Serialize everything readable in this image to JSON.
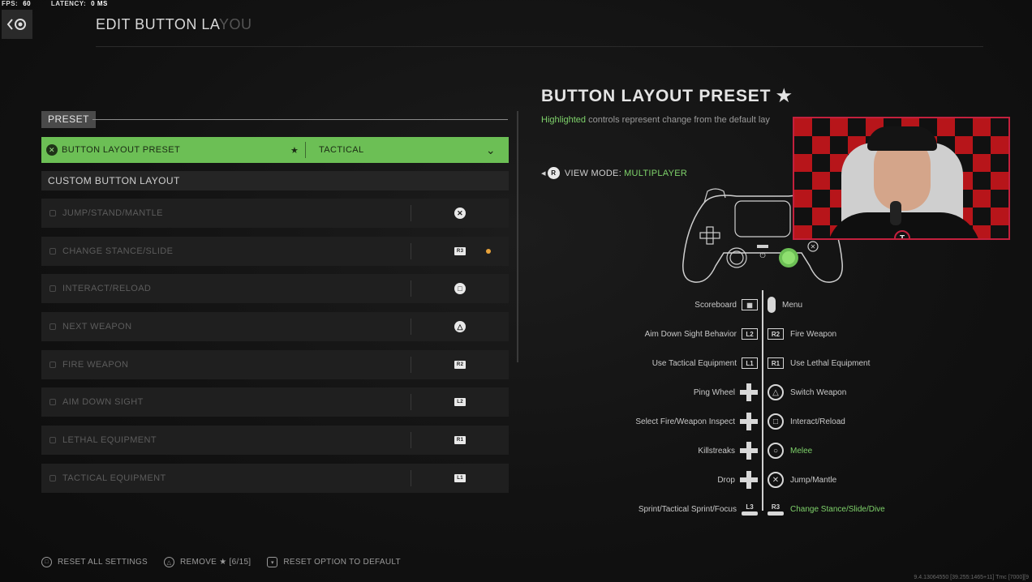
{
  "stats": {
    "fps_label": "FPS:",
    "fps_value": "60",
    "latency_label": "LATENCY:",
    "latency_value": "0 MS"
  },
  "header": {
    "title_visible": "EDIT BUTTON LA",
    "title_faded": "YOU"
  },
  "left": {
    "preset_tag": "PRESET",
    "preset_row": {
      "label": "BUTTON LAYOUT PRESET",
      "star": "★",
      "value": "TACTICAL",
      "bg_color": "#6cbf55"
    },
    "custom_header": "CUSTOM BUTTON LAYOUT",
    "rows": [
      {
        "label": "JUMP/STAND/MANTLE",
        "button": "✕",
        "button_type": "circle"
      },
      {
        "label": "CHANGE STANCE/SLIDE",
        "button": "R3",
        "button_type": "stick",
        "changed": true
      },
      {
        "label": "INTERACT/RELOAD",
        "button": "□",
        "button_type": "circle"
      },
      {
        "label": "NEXT WEAPON",
        "button": "△",
        "button_type": "circle"
      },
      {
        "label": "FIRE WEAPON",
        "button": "R2",
        "button_type": "tag"
      },
      {
        "label": "AIM DOWN SIGHT",
        "button": "L2",
        "button_type": "tag"
      },
      {
        "label": "LETHAL EQUIPMENT",
        "button": "R1",
        "button_type": "tag"
      },
      {
        "label": "TACTICAL EQUIPMENT",
        "button": "L1",
        "button_type": "tag"
      }
    ]
  },
  "footer": {
    "reset_all": "RESET ALL SETTINGS",
    "remove": "REMOVE ★ [6/15]",
    "reset_option": "RESET OPTION TO DEFAULT",
    "build": "9.4.13064550 [39.255:1465+11] Tmc [7000][9"
  },
  "right": {
    "title": "BUTTON LAYOUT PRESET ★",
    "note_highlight": "Highlighted",
    "note_rest": " controls represent change from the default lay",
    "view_mode_label": "VIEW MODE:",
    "view_mode_value": "MULTIPLAYER",
    "accent_color": "#7fd36b",
    "mapping_left": [
      {
        "label": "Scoreboard",
        "icon": "touchpad-icon"
      },
      {
        "label": "Aim Down Sight Behavior",
        "icon": "L2"
      },
      {
        "label": "Use Tactical Equipment",
        "icon": "L1"
      },
      {
        "label": "Ping Wheel",
        "icon": "dpad-icon"
      },
      {
        "label": "Select Fire/Weapon Inspect",
        "icon": "dpad-icon"
      },
      {
        "label": "Killstreaks",
        "icon": "dpad-icon"
      },
      {
        "label": "Drop",
        "icon": "dpad-icon"
      },
      {
        "label": "Sprint/Tactical Sprint/Focus",
        "icon": "L3"
      }
    ],
    "mapping_right": [
      {
        "label": "Menu",
        "icon": "options-icon",
        "highlighted": false
      },
      {
        "label": "Fire Weapon",
        "icon": "R2",
        "highlighted": false
      },
      {
        "label": "Use Lethal Equipment",
        "icon": "R1",
        "highlighted": false
      },
      {
        "label": "Switch Weapon",
        "icon": "△",
        "highlighted": false
      },
      {
        "label": "Interact/Reload",
        "icon": "□",
        "highlighted": false
      },
      {
        "label": "Melee",
        "icon": "○",
        "highlighted": true
      },
      {
        "label": "Jump/Mantle",
        "icon": "✕",
        "highlighted": false
      },
      {
        "label": "Change Stance/Slide/Dive",
        "icon": "R3",
        "highlighted": true
      }
    ]
  },
  "webcam": {
    "border_color": "#c3203d"
  }
}
